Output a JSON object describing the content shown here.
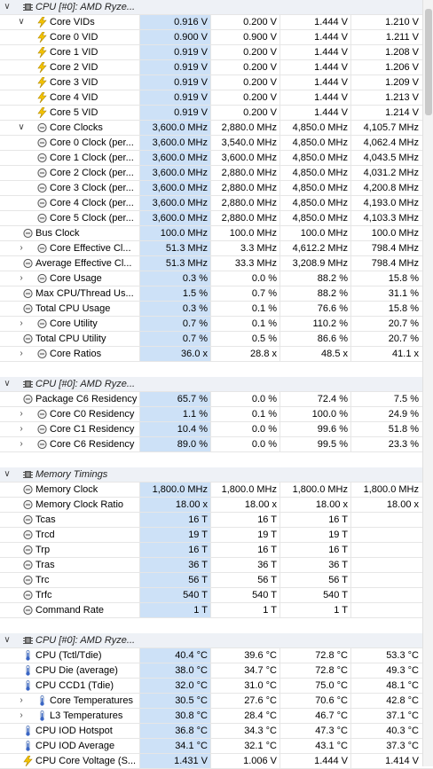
{
  "rows": [
    {
      "kind": "group",
      "indent": 0,
      "expander": "collapse",
      "icon": "chip-icon",
      "label": "CPU [#0]: AMD Ryze...",
      "cur": "",
      "min": "",
      "max": "",
      "avg": ""
    },
    {
      "kind": "data",
      "indent": 1,
      "expander": "collapse",
      "icon": "voltage-icon",
      "label": "Core VIDs",
      "cur": "0.916 V",
      "min": "0.200 V",
      "max": "1.444 V",
      "avg": "1.210 V"
    },
    {
      "kind": "data",
      "indent": 2,
      "expander": "none",
      "icon": "voltage-icon",
      "label": "Core 0 VID",
      "cur": "0.900 V",
      "min": "0.900 V",
      "max": "1.444 V",
      "avg": "1.211 V"
    },
    {
      "kind": "data",
      "indent": 2,
      "expander": "none",
      "icon": "voltage-icon",
      "label": "Core 1 VID",
      "cur": "0.919 V",
      "min": "0.200 V",
      "max": "1.444 V",
      "avg": "1.208 V"
    },
    {
      "kind": "data",
      "indent": 2,
      "expander": "none",
      "icon": "voltage-icon",
      "label": "Core 2 VID",
      "cur": "0.919 V",
      "min": "0.200 V",
      "max": "1.444 V",
      "avg": "1.206 V"
    },
    {
      "kind": "data",
      "indent": 2,
      "expander": "none",
      "icon": "voltage-icon",
      "label": "Core 3 VID",
      "cur": "0.919 V",
      "min": "0.200 V",
      "max": "1.444 V",
      "avg": "1.209 V"
    },
    {
      "kind": "data",
      "indent": 2,
      "expander": "none",
      "icon": "voltage-icon",
      "label": "Core 4 VID",
      "cur": "0.919 V",
      "min": "0.200 V",
      "max": "1.444 V",
      "avg": "1.213 V"
    },
    {
      "kind": "data",
      "indent": 2,
      "expander": "none",
      "icon": "voltage-icon",
      "label": "Core 5 VID",
      "cur": "0.919 V",
      "min": "0.200 V",
      "max": "1.444 V",
      "avg": "1.214 V"
    },
    {
      "kind": "data",
      "indent": 1,
      "expander": "collapse",
      "icon": "clock-icon",
      "label": "Core Clocks",
      "cur": "3,600.0 MHz",
      "min": "2,880.0 MHz",
      "max": "4,850.0 MHz",
      "avg": "4,105.7 MHz"
    },
    {
      "kind": "data",
      "indent": 2,
      "expander": "none",
      "icon": "clock-icon",
      "label": "Core 0 Clock (per...",
      "cur": "3,600.0 MHz",
      "min": "3,540.0 MHz",
      "max": "4,850.0 MHz",
      "avg": "4,062.4 MHz"
    },
    {
      "kind": "data",
      "indent": 2,
      "expander": "none",
      "icon": "clock-icon",
      "label": "Core 1 Clock (per...",
      "cur": "3,600.0 MHz",
      "min": "3,600.0 MHz",
      "max": "4,850.0 MHz",
      "avg": "4,043.5 MHz"
    },
    {
      "kind": "data",
      "indent": 2,
      "expander": "none",
      "icon": "clock-icon",
      "label": "Core 2 Clock (per...",
      "cur": "3,600.0 MHz",
      "min": "2,880.0 MHz",
      "max": "4,850.0 MHz",
      "avg": "4,031.2 MHz"
    },
    {
      "kind": "data",
      "indent": 2,
      "expander": "none",
      "icon": "clock-icon",
      "label": "Core 3 Clock (per...",
      "cur": "3,600.0 MHz",
      "min": "2,880.0 MHz",
      "max": "4,850.0 MHz",
      "avg": "4,200.8 MHz"
    },
    {
      "kind": "data",
      "indent": 2,
      "expander": "none",
      "icon": "clock-icon",
      "label": "Core 4 Clock (per...",
      "cur": "3,600.0 MHz",
      "min": "2,880.0 MHz",
      "max": "4,850.0 MHz",
      "avg": "4,193.0 MHz"
    },
    {
      "kind": "data",
      "indent": 2,
      "expander": "none",
      "icon": "clock-icon",
      "label": "Core 5 Clock (per...",
      "cur": "3,600.0 MHz",
      "min": "2,880.0 MHz",
      "max": "4,850.0 MHz",
      "avg": "4,103.3 MHz"
    },
    {
      "kind": "data",
      "indent": 0,
      "expander": "none",
      "icon": "clock-icon",
      "label": "Bus Clock",
      "cur": "100.0 MHz",
      "min": "100.0 MHz",
      "max": "100.0 MHz",
      "avg": "100.0 MHz"
    },
    {
      "kind": "data",
      "indent": 1,
      "expander": "expand",
      "icon": "clock-icon",
      "label": "Core Effective Cl...",
      "cur": "51.3 MHz",
      "min": "3.3 MHz",
      "max": "4,612.2 MHz",
      "avg": "798.4 MHz"
    },
    {
      "kind": "data",
      "indent": 0,
      "expander": "none",
      "icon": "clock-icon",
      "label": "Average Effective Cl...",
      "cur": "51.3 MHz",
      "min": "33.3 MHz",
      "max": "3,208.9 MHz",
      "avg": "798.4 MHz"
    },
    {
      "kind": "data",
      "indent": 1,
      "expander": "expand",
      "icon": "clock-icon",
      "label": "Core Usage",
      "cur": "0.3 %",
      "min": "0.0 %",
      "max": "88.2 %",
      "avg": "15.8 %"
    },
    {
      "kind": "data",
      "indent": 0,
      "expander": "none",
      "icon": "clock-icon",
      "label": "Max CPU/Thread Us...",
      "cur": "1.5 %",
      "min": "0.7 %",
      "max": "88.2 %",
      "avg": "31.1 %"
    },
    {
      "kind": "data",
      "indent": 0,
      "expander": "none",
      "icon": "clock-icon",
      "label": "Total CPU Usage",
      "cur": "0.3 %",
      "min": "0.1 %",
      "max": "76.6 %",
      "avg": "15.8 %"
    },
    {
      "kind": "data",
      "indent": 1,
      "expander": "expand",
      "icon": "clock-icon",
      "label": "Core Utility",
      "cur": "0.7 %",
      "min": "0.1 %",
      "max": "110.2 %",
      "avg": "20.7 %"
    },
    {
      "kind": "data",
      "indent": 0,
      "expander": "none",
      "icon": "clock-icon",
      "label": "Total CPU Utility",
      "cur": "0.7 %",
      "min": "0.5 %",
      "max": "86.6 %",
      "avg": "20.7 %"
    },
    {
      "kind": "data",
      "indent": 1,
      "expander": "expand",
      "icon": "clock-icon",
      "label": "Core Ratios",
      "cur": "36.0 x",
      "min": "28.8 x",
      "max": "48.5 x",
      "avg": "41.1 x"
    },
    {
      "kind": "blank"
    },
    {
      "kind": "group",
      "indent": 0,
      "expander": "collapse",
      "icon": "chip-icon",
      "label": "CPU [#0]: AMD Ryze...",
      "cur": "",
      "min": "",
      "max": "",
      "avg": ""
    },
    {
      "kind": "data",
      "indent": 0,
      "expander": "none",
      "icon": "clock-icon",
      "label": "Package C6 Residency",
      "cur": "65.7 %",
      "min": "0.0 %",
      "max": "72.4 %",
      "avg": "7.5 %"
    },
    {
      "kind": "data",
      "indent": 1,
      "expander": "expand",
      "icon": "clock-icon",
      "label": "Core C0 Residency",
      "cur": "1.1 %",
      "min": "0.1 %",
      "max": "100.0 %",
      "avg": "24.9 %"
    },
    {
      "kind": "data",
      "indent": 1,
      "expander": "expand",
      "icon": "clock-icon",
      "label": "Core C1 Residency",
      "cur": "10.4 %",
      "min": "0.0 %",
      "max": "99.6 %",
      "avg": "51.8 %"
    },
    {
      "kind": "data",
      "indent": 1,
      "expander": "expand",
      "icon": "clock-icon",
      "label": "Core C6 Residency",
      "cur": "89.0 %",
      "min": "0.0 %",
      "max": "99.5 %",
      "avg": "23.3 %"
    },
    {
      "kind": "blank"
    },
    {
      "kind": "group",
      "indent": 0,
      "expander": "collapse",
      "icon": "chip-icon",
      "label": "Memory Timings",
      "cur": "",
      "min": "",
      "max": "",
      "avg": ""
    },
    {
      "kind": "data",
      "indent": 0,
      "expander": "none",
      "icon": "clock-icon",
      "label": "Memory Clock",
      "cur": "1,800.0 MHz",
      "min": "1,800.0 MHz",
      "max": "1,800.0 MHz",
      "avg": "1,800.0 MHz"
    },
    {
      "kind": "data",
      "indent": 0,
      "expander": "none",
      "icon": "clock-icon",
      "label": "Memory Clock Ratio",
      "cur": "18.00 x",
      "min": "18.00 x",
      "max": "18.00 x",
      "avg": "18.00 x"
    },
    {
      "kind": "data",
      "indent": 0,
      "expander": "none",
      "icon": "clock-icon",
      "label": "Tcas",
      "cur": "16 T",
      "min": "16 T",
      "max": "16 T",
      "avg": ""
    },
    {
      "kind": "data",
      "indent": 0,
      "expander": "none",
      "icon": "clock-icon",
      "label": "Trcd",
      "cur": "19 T",
      "min": "19 T",
      "max": "19 T",
      "avg": ""
    },
    {
      "kind": "data",
      "indent": 0,
      "expander": "none",
      "icon": "clock-icon",
      "label": "Trp",
      "cur": "16 T",
      "min": "16 T",
      "max": "16 T",
      "avg": ""
    },
    {
      "kind": "data",
      "indent": 0,
      "expander": "none",
      "icon": "clock-icon",
      "label": "Tras",
      "cur": "36 T",
      "min": "36 T",
      "max": "36 T",
      "avg": ""
    },
    {
      "kind": "data",
      "indent": 0,
      "expander": "none",
      "icon": "clock-icon",
      "label": "Trc",
      "cur": "56 T",
      "min": "56 T",
      "max": "56 T",
      "avg": ""
    },
    {
      "kind": "data",
      "indent": 0,
      "expander": "none",
      "icon": "clock-icon",
      "label": "Trfc",
      "cur": "540 T",
      "min": "540 T",
      "max": "540 T",
      "avg": ""
    },
    {
      "kind": "data",
      "indent": 0,
      "expander": "none",
      "icon": "clock-icon",
      "label": "Command Rate",
      "cur": "1 T",
      "min": "1 T",
      "max": "1 T",
      "avg": ""
    },
    {
      "kind": "blank"
    },
    {
      "kind": "group",
      "indent": 0,
      "expander": "collapse",
      "icon": "chip-icon",
      "label": "CPU [#0]: AMD Ryze...",
      "cur": "",
      "min": "",
      "max": "",
      "avg": ""
    },
    {
      "kind": "data",
      "indent": 0,
      "expander": "none",
      "icon": "thermometer-icon",
      "label": "CPU (Tctl/Tdie)",
      "cur": "40.4 °C",
      "min": "39.6 °C",
      "max": "72.8 °C",
      "avg": "53.3 °C"
    },
    {
      "kind": "data",
      "indent": 0,
      "expander": "none",
      "icon": "thermometer-icon",
      "label": "CPU Die (average)",
      "cur": "38.0 °C",
      "min": "34.7 °C",
      "max": "72.8 °C",
      "avg": "49.3 °C"
    },
    {
      "kind": "data",
      "indent": 0,
      "expander": "none",
      "icon": "thermometer-icon",
      "label": "CPU CCD1 (Tdie)",
      "cur": "32.0 °C",
      "min": "31.0 °C",
      "max": "75.0 °C",
      "avg": "48.1 °C"
    },
    {
      "kind": "data",
      "indent": 1,
      "expander": "expand",
      "icon": "thermometer-icon",
      "label": "Core Temperatures",
      "cur": "30.5 °C",
      "min": "27.6 °C",
      "max": "70.6 °C",
      "avg": "42.8 °C"
    },
    {
      "kind": "data",
      "indent": 1,
      "expander": "expand",
      "icon": "thermometer-icon",
      "label": "L3 Temperatures",
      "cur": "30.8 °C",
      "min": "28.4 °C",
      "max": "46.7 °C",
      "avg": "37.1 °C"
    },
    {
      "kind": "data",
      "indent": 0,
      "expander": "none",
      "icon": "thermometer-icon",
      "label": "CPU IOD Hotspot",
      "cur": "36.8 °C",
      "min": "34.3 °C",
      "max": "47.3 °C",
      "avg": "40.3 °C"
    },
    {
      "kind": "data",
      "indent": 0,
      "expander": "none",
      "icon": "thermometer-icon",
      "label": "CPU IOD Average",
      "cur": "34.1 °C",
      "min": "32.1 °C",
      "max": "43.1 °C",
      "avg": "37.3 °C"
    },
    {
      "kind": "data",
      "indent": 0,
      "expander": "none",
      "icon": "voltage-icon",
      "label": "CPU Core Voltage (S...",
      "cur": "1.431 V",
      "min": "1.006 V",
      "max": "1.444 V",
      "avg": "1.414 V"
    }
  ],
  "colors": {
    "highlight": "#cde1f7",
    "groupbg": "#eef1f6",
    "grid": "#e6e6e6"
  }
}
